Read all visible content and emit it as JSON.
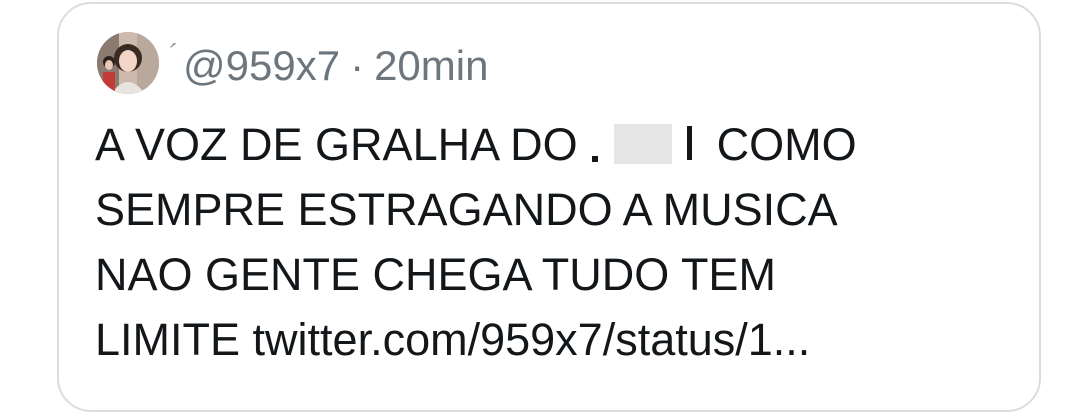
{
  "tweet": {
    "handle": "@959x7",
    "separator": "·",
    "time": "20min",
    "lines": [
      {
        "before": "A VOZ DE GRALHA DO ",
        "after": " COMO"
      },
      "SEMPRE ESTRAGANDO A MUSICA",
      "NAO GENTE CHEGA TUDO TEM",
      {
        "word": "LIMITE",
        "link": "twitter.com/959x7/status/1..."
      }
    ]
  },
  "icons": {
    "avatar": "profile-photo",
    "redaction": "redacted-name"
  }
}
